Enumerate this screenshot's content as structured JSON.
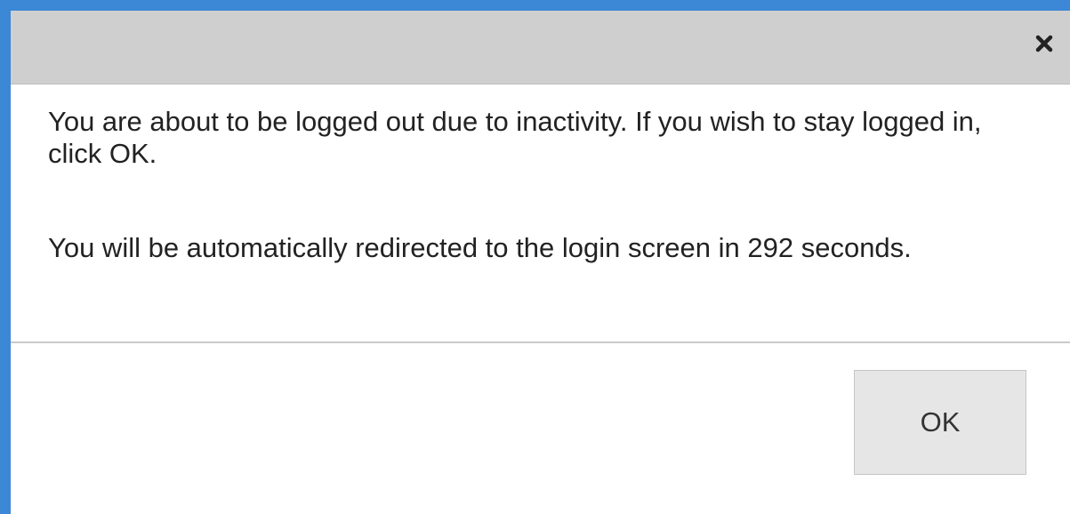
{
  "dialog": {
    "close_icon": "close-icon",
    "message_line_1": "You are about to be logged out due to inactivity. If you wish to stay logged in, click OK.",
    "message_line_2_prefix": "You will be automatically redirected to the login screen in ",
    "countdown_seconds": "292",
    "message_line_2_suffix": " seconds.",
    "ok_label": "OK"
  },
  "colors": {
    "background_accent": "#3c87d6",
    "titlebar": "#cfcfcf",
    "button": "#e6e6e6"
  }
}
